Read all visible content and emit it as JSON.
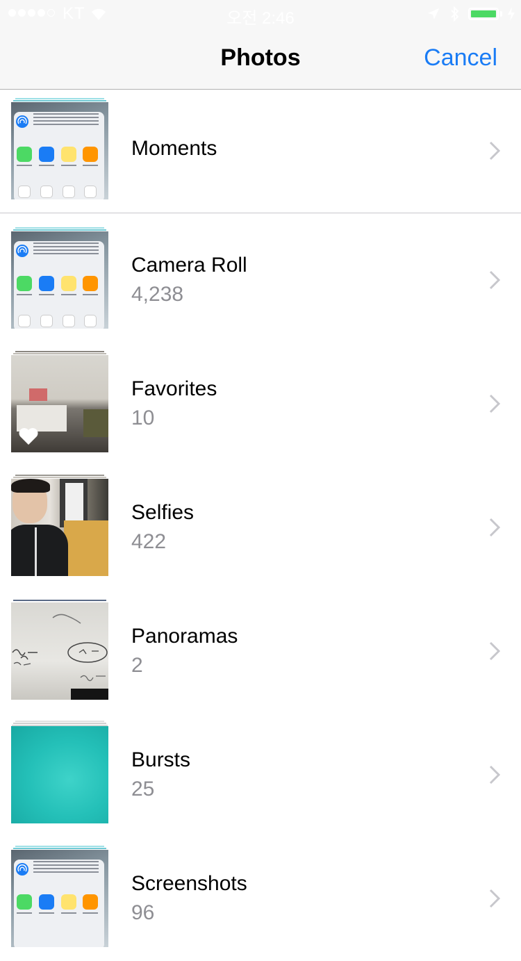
{
  "status_bar": {
    "carrier": "KT",
    "time": "오전 2:46",
    "battery_level": 1.0,
    "accent": "#4cd964"
  },
  "nav": {
    "title": "Photos",
    "cancel_label": "Cancel",
    "accent": "#1a7cf5"
  },
  "albums": [
    {
      "name": "Moments",
      "count": null,
      "thumbnail": "screenshot"
    },
    {
      "name": "Camera Roll",
      "count": "4,238",
      "thumbnail": "screenshot"
    },
    {
      "name": "Favorites",
      "count": "10",
      "thumbnail": "room-photo",
      "badge_icon": "heart-icon"
    },
    {
      "name": "Selfies",
      "count": "422",
      "thumbnail": "selfie-photo"
    },
    {
      "name": "Panoramas",
      "count": "2",
      "thumbnail": "whiteboard-photo"
    },
    {
      "name": "Bursts",
      "count": "25",
      "thumbnail": "underwater-photo"
    },
    {
      "name": "Screenshots",
      "count": "96",
      "thumbnail": "screenshot"
    }
  ]
}
